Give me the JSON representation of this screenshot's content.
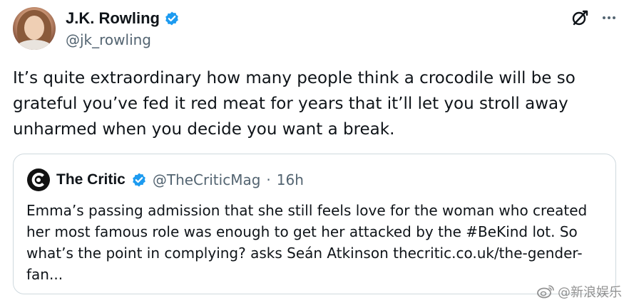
{
  "tweet": {
    "author": {
      "display_name": "J.K. Rowling",
      "handle": "@jk_rowling",
      "verified": true
    },
    "text": "It’s quite extraordinary how many people think a crocodile will be so grateful you’ve fed it red meat for years that it’ll let you stroll away unharmed when you decide you want a break.",
    "actions": {
      "grok_icon": "grok-icon",
      "more_icon": "more-icon"
    }
  },
  "quote": {
    "author": {
      "display_name": "The Critic",
      "handle": "@TheCriticMag",
      "separator": "·",
      "time": "16h",
      "verified": true
    },
    "text": "Emma’s passing admission that she still feels love for the woman who created her most famous role was enough to get her attacked by the #BeKind lot. So what’s the point in complying? asks Seán Atkinson thecritic.co.uk/the-gender-fan..."
  },
  "watermark": {
    "text": "@新浪娱乐"
  },
  "colors": {
    "verified_blue": "#1d9bf0",
    "text_primary": "#0f1419",
    "text_secondary": "#536471",
    "border": "#cfd9de"
  }
}
